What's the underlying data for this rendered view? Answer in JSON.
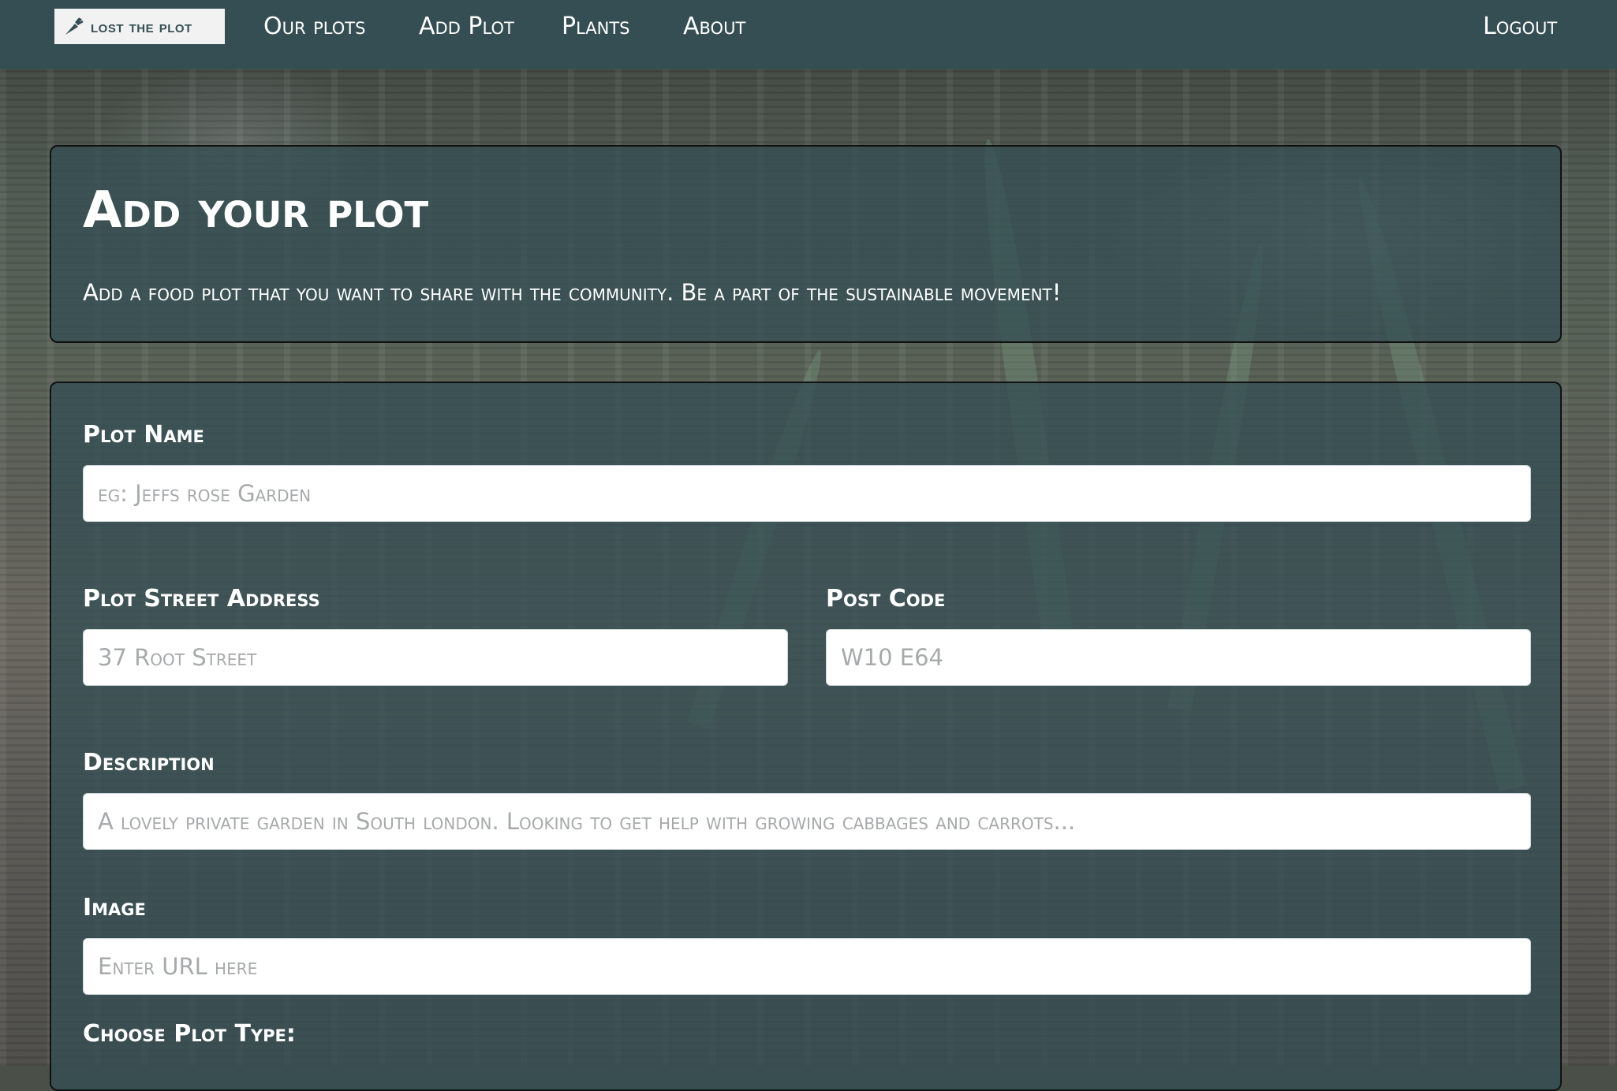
{
  "nav": {
    "brand": "lost the plot",
    "links": [
      "Our plots",
      "Add Plot",
      "Plants",
      "About"
    ],
    "logout": "Logout"
  },
  "hero": {
    "title": "Add your plot",
    "subtitle": "Add a food plot that you want to share with the community. Be a part of the sustainable movement!"
  },
  "form": {
    "plot_name": {
      "label": "Plot Name",
      "placeholder": "eg: Jeffs rose Garden"
    },
    "street_address": {
      "label": "Plot Street Address",
      "placeholder": "37 Root Street"
    },
    "post_code": {
      "label": "Post Code",
      "placeholder": "W10 E64"
    },
    "description": {
      "label": "Description",
      "placeholder": "A lovely private garden in South london. Looking to get help with growing cabbages and carrots..."
    },
    "image": {
      "label": "Image",
      "placeholder": "Enter URL here"
    },
    "plot_type": {
      "label": "Choose Plot Type:"
    }
  }
}
